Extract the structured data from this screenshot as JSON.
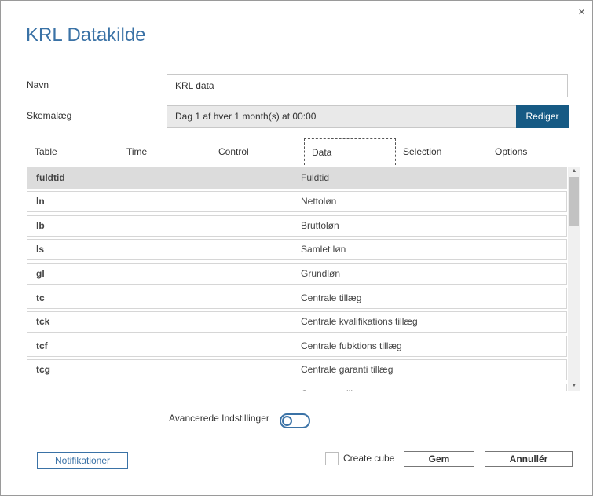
{
  "dialog": {
    "title": "KRL Datakilde",
    "close_glyph": "×"
  },
  "form": {
    "name_label": "Navn",
    "name_value": "KRL data",
    "schedule_label": "Skemalæg",
    "schedule_value": "Dag 1 af hver 1 month(s) at 00:00",
    "edit_label": "Rediger"
  },
  "tabs": [
    {
      "label": "Table"
    },
    {
      "label": "Time"
    },
    {
      "label": "Control"
    },
    {
      "label": "Data",
      "active": true
    },
    {
      "label": "Selection"
    },
    {
      "label": "Options"
    }
  ],
  "rows": [
    {
      "key": "fuldtid",
      "value": "Fuldtid",
      "selected": true
    },
    {
      "key": "ln",
      "value": "Nettoløn"
    },
    {
      "key": "lb",
      "value": "Bruttoløn"
    },
    {
      "key": "ls",
      "value": "Samlet løn"
    },
    {
      "key": "gl",
      "value": "Grundløn"
    },
    {
      "key": "tc",
      "value": "Centrale tillæg"
    },
    {
      "key": "tck",
      "value": "Centrale kvalifikations tillæg"
    },
    {
      "key": "tcf",
      "value": "Centrale fubktions tillæg"
    },
    {
      "key": "tcg",
      "value": "Centrale garanti tillæg"
    },
    {
      "key": "t",
      "value": "Overenss tillæg"
    }
  ],
  "icons": {
    "close": "close-icon",
    "scroll_up": "chevron-up-icon",
    "scroll_down": "chevron-down-icon",
    "scroll_up_glyph": "▲",
    "scroll_down_glyph": "▼"
  },
  "advanced": {
    "label": "Avancerede Indstillinger",
    "enabled": false
  },
  "footer": {
    "notifications_label": "Notifikationer",
    "create_cube_label": "Create cube",
    "create_cube_checked": false,
    "save_label": "Gem",
    "cancel_label": "Annullér"
  },
  "colors": {
    "accent": "#3a72a6",
    "primary_button": "#165a84",
    "selected_row": "#dcdcdc"
  }
}
